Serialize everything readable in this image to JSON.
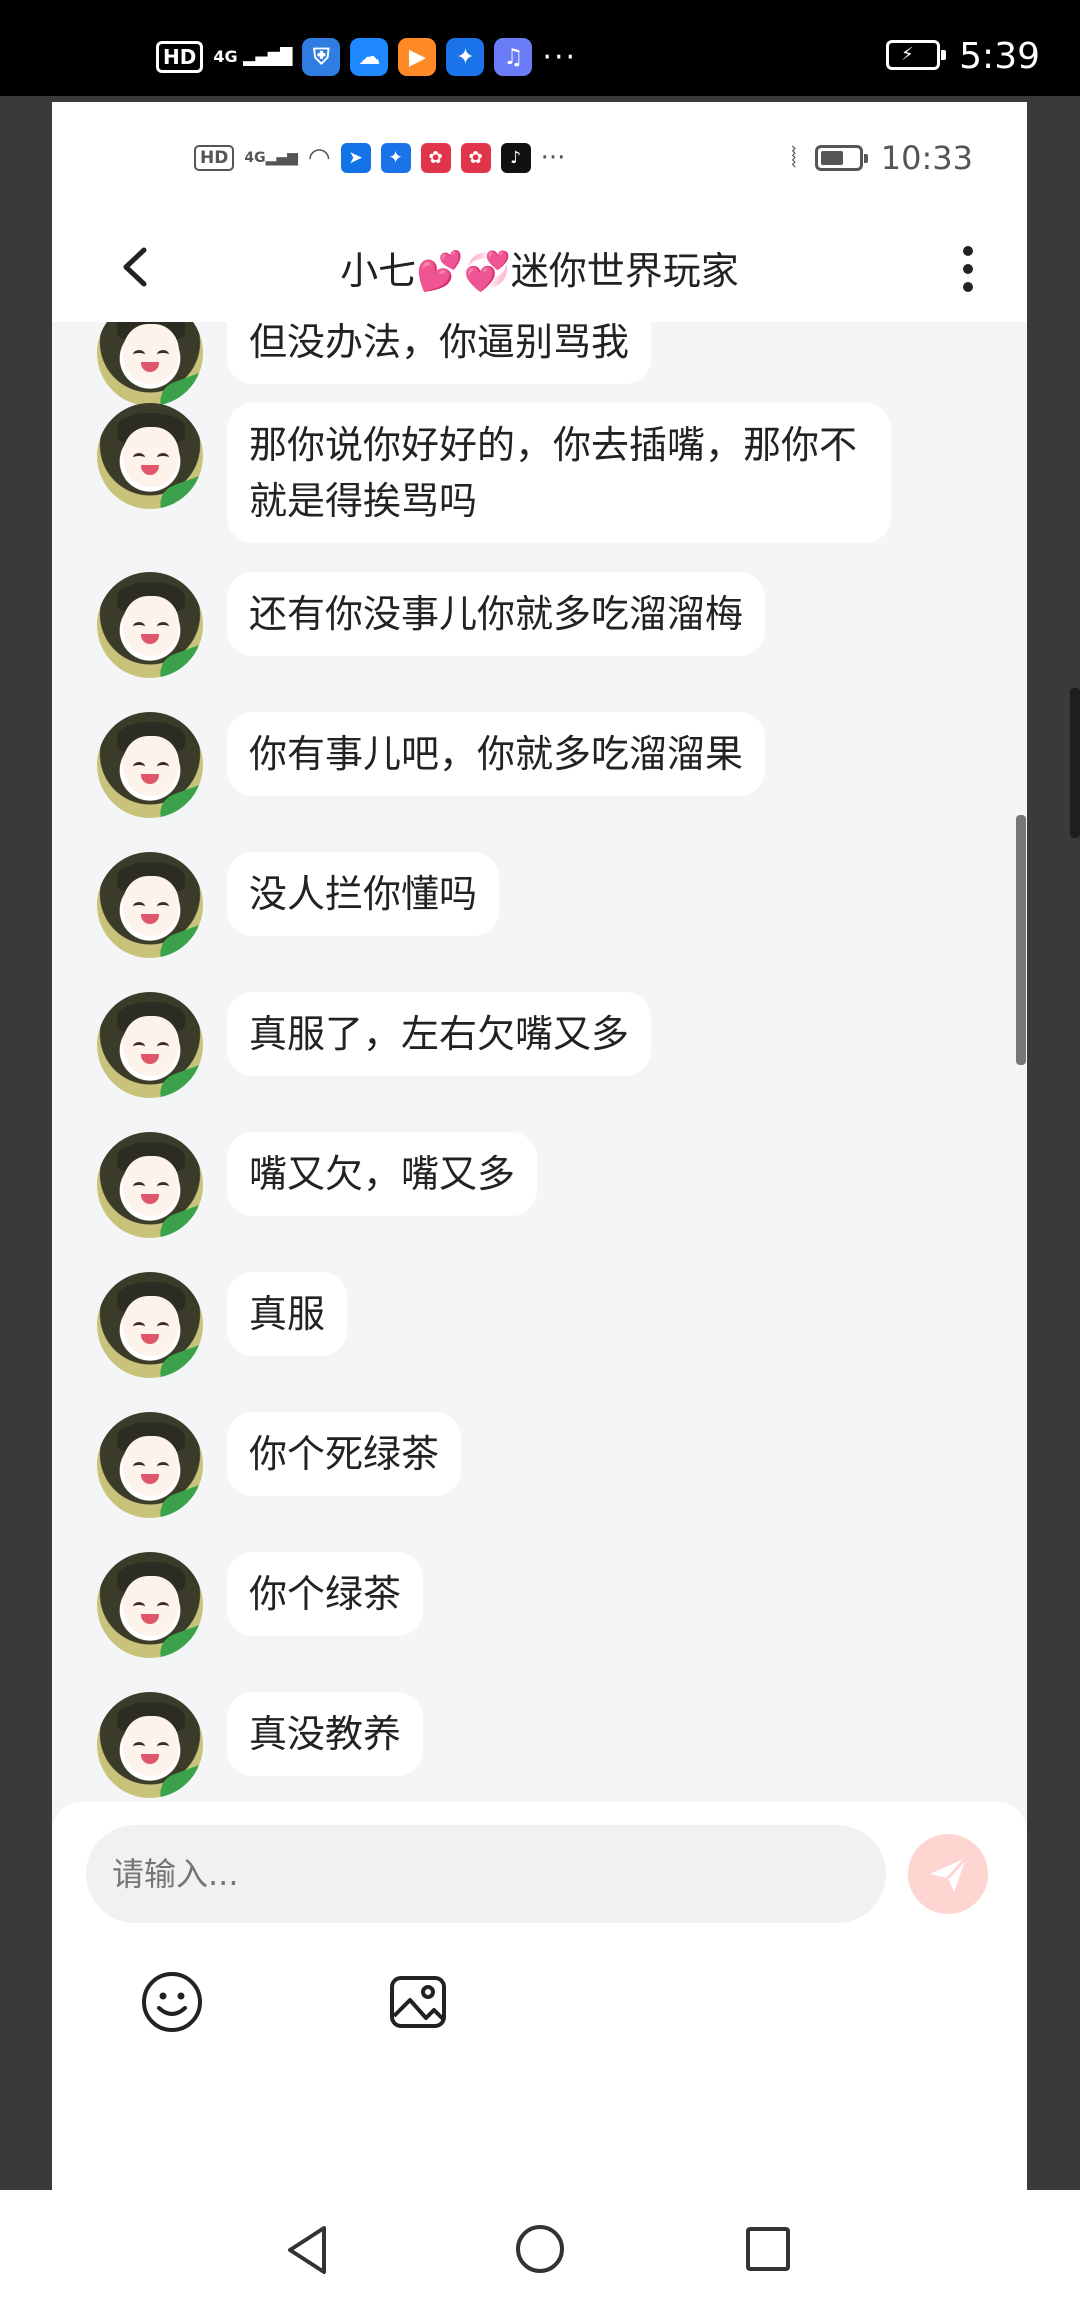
{
  "outer_status": {
    "time": "5:39",
    "network": "4G",
    "hd": "HD",
    "more": "···"
  },
  "inner_status": {
    "time": "10:33",
    "network": "4G",
    "hd": "HD",
    "more": "···",
    "battery_level": 0.6
  },
  "header": {
    "title": "小七💕💞迷你世界玩家"
  },
  "messages": [
    {
      "text": "但没办法，你逼别骂我"
    },
    {
      "text": "那你说你好好的，你去插嘴，那你不就是得挨骂吗"
    },
    {
      "text": "还有你没事儿你就多吃溜溜梅"
    },
    {
      "text": "你有事儿吧，你就多吃溜溜果"
    },
    {
      "text": "没人拦你懂吗"
    },
    {
      "text": "真服了，左右欠嘴又多"
    },
    {
      "text": "嘴又欠，嘴又多"
    },
    {
      "text": "真服"
    },
    {
      "text": "你个死绿茶"
    },
    {
      "text": "你个绿茶"
    },
    {
      "text": "真没教养"
    }
  ],
  "composer": {
    "placeholder": "请输入..."
  },
  "colors": {
    "send_button": "#ffd5d2",
    "chat_bg": "#f4f5f7"
  }
}
